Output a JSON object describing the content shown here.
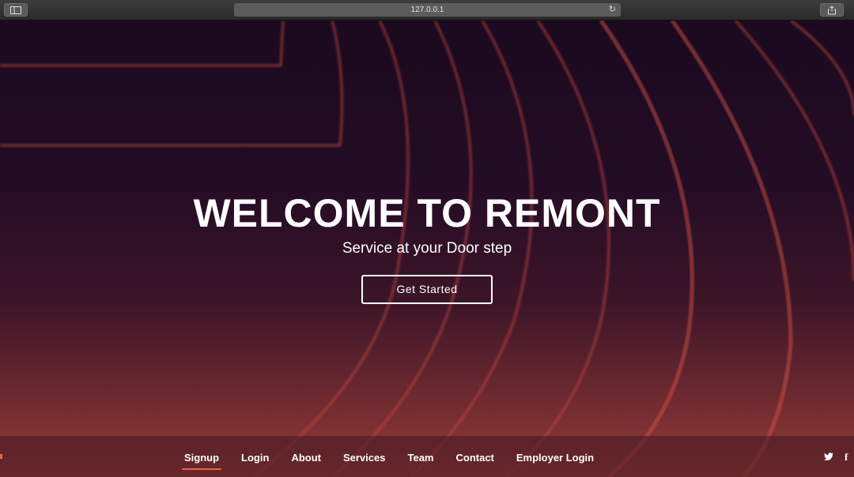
{
  "browser": {
    "url": "127.0.0.1",
    "reload_icon": "reload-icon",
    "sidebar_icon": "sidebar-icon",
    "share_icon": "share-icon"
  },
  "hero": {
    "title": "WELCOME TO REMONT",
    "subtitle": "Service at your Door step",
    "cta_label": "Get Started"
  },
  "nav": {
    "items": [
      {
        "label": "Signup",
        "active": true
      },
      {
        "label": "Login"
      },
      {
        "label": "About"
      },
      {
        "label": "Services"
      },
      {
        "label": "Team"
      },
      {
        "label": "Contact"
      },
      {
        "label": "Employer Login"
      }
    ],
    "social": [
      "twitter-icon",
      "facebook-icon"
    ]
  },
  "colors": {
    "accent": "#e8614a",
    "background_top": "#1b0a1f",
    "background_bottom": "#9a3d38"
  }
}
